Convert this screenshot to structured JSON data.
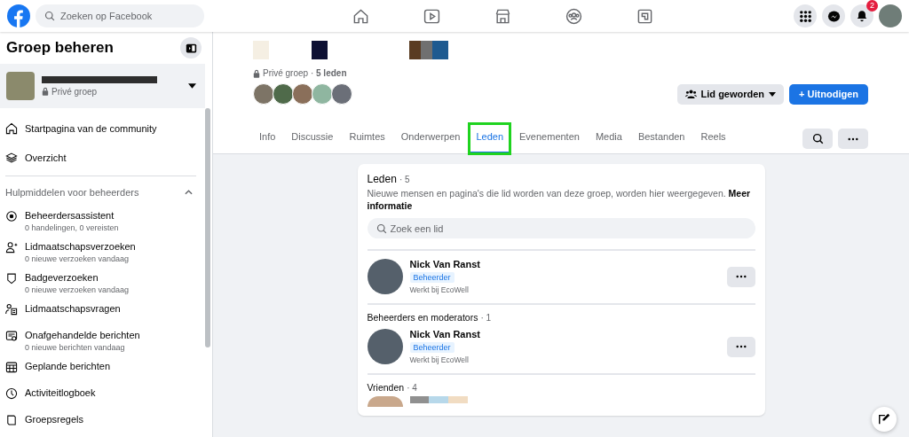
{
  "header": {
    "search_placeholder": "Zoeken op Facebook",
    "notification_count": "2"
  },
  "sidebar": {
    "title": "Groep beheren",
    "group": {
      "privacy": "Privé groep"
    },
    "nav": [
      {
        "label": "Startpagina van de community"
      },
      {
        "label": "Overzicht"
      }
    ],
    "section": {
      "title": "Hulpmiddelen voor beheerders",
      "expanded": true
    },
    "tools": [
      {
        "label": "Beheerdersassistent",
        "detail": "0 handelingen, 0 vereisten"
      },
      {
        "label": "Lidmaatschapsverzoeken",
        "detail": "0 nieuwe verzoeken vandaag"
      },
      {
        "label": "Badgeverzoeken",
        "detail": "0 nieuwe verzoeken vandaag"
      },
      {
        "label": "Lidmaatschapsvragen"
      },
      {
        "label": "Onafgehandelde berichten",
        "detail": "0 nieuwe berichten vandaag"
      },
      {
        "label": "Geplande berichten"
      },
      {
        "label": "Activiteitlogboek"
      },
      {
        "label": "Groepsregels"
      }
    ]
  },
  "group": {
    "meta": "Privé groep · **5 leden**",
    "join_button": "Lid geworden",
    "invite_button": "+ Uitnodigen",
    "tabs": [
      {
        "label": "Info",
        "selected": false
      },
      {
        "label": "Discussie",
        "selected": false
      },
      {
        "label": "Ruimtes",
        "selected": false
      },
      {
        "label": "Onderwerpen",
        "selected": false
      },
      {
        "label": "Leden",
        "selected": true
      },
      {
        "label": "Evenementen",
        "selected": false
      },
      {
        "label": "Media",
        "selected": false
      },
      {
        "label": "Bestanden",
        "selected": false
      },
      {
        "label": "Reels",
        "selected": false
      }
    ]
  },
  "members": {
    "title": "Leden",
    "count": "· 5",
    "description": "Nieuwe mensen en pagina's die lid worden van deze groep, worden hier weergegeven. **Meer informatie**",
    "search_placeholder": "Zoek een lid",
    "sections": [
      {
        "members": [
          {
            "name": "Nick Van Ranst",
            "role": "Beheerder",
            "work": "Werkt bij EcoWell"
          }
        ]
      },
      {
        "title": "Beheerders en moderators",
        "count": "· 1",
        "members": [
          {
            "name": "Nick Van Ranst",
            "role": "Beheerder",
            "work": "Werkt bij EcoWell"
          }
        ]
      },
      {
        "title": "Vrienden",
        "count": "· 4"
      }
    ]
  }
}
